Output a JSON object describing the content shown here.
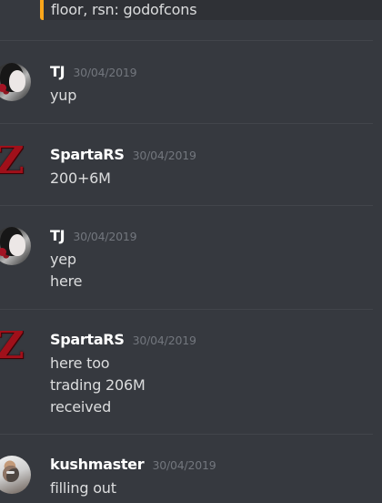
{
  "top_embed": {
    "text": "floor, rsn: godofcons",
    "accent_color": "#faa61a"
  },
  "messages": [
    {
      "username": "TJ",
      "timestamp": "30/04/2019",
      "avatar_icon": "tj-avatar-icon",
      "lines": [
        "yup"
      ]
    },
    {
      "username": "SpartaRS",
      "timestamp": "30/04/2019",
      "avatar_icon": "z-logo-avatar-icon",
      "avatar_glyph": "Z",
      "lines": [
        "200+6M"
      ]
    },
    {
      "username": "TJ",
      "timestamp": "30/04/2019",
      "avatar_icon": "tj-avatar-icon",
      "lines": [
        "yep",
        "here"
      ]
    },
    {
      "username": "SpartaRS",
      "timestamp": "30/04/2019",
      "avatar_icon": "z-logo-avatar-icon",
      "avatar_glyph": "Z",
      "lines": [
        "here too",
        "trading 206M",
        "received"
      ]
    },
    {
      "username": "kushmaster",
      "timestamp": "30/04/2019",
      "avatar_icon": "kushmaster-avatar-icon",
      "lines": [
        "filling out"
      ]
    }
  ],
  "colors": {
    "background": "#36393f",
    "text": "#dcddde",
    "username": "#ffffff",
    "timestamp": "#72767d",
    "divider": "#42454b"
  }
}
